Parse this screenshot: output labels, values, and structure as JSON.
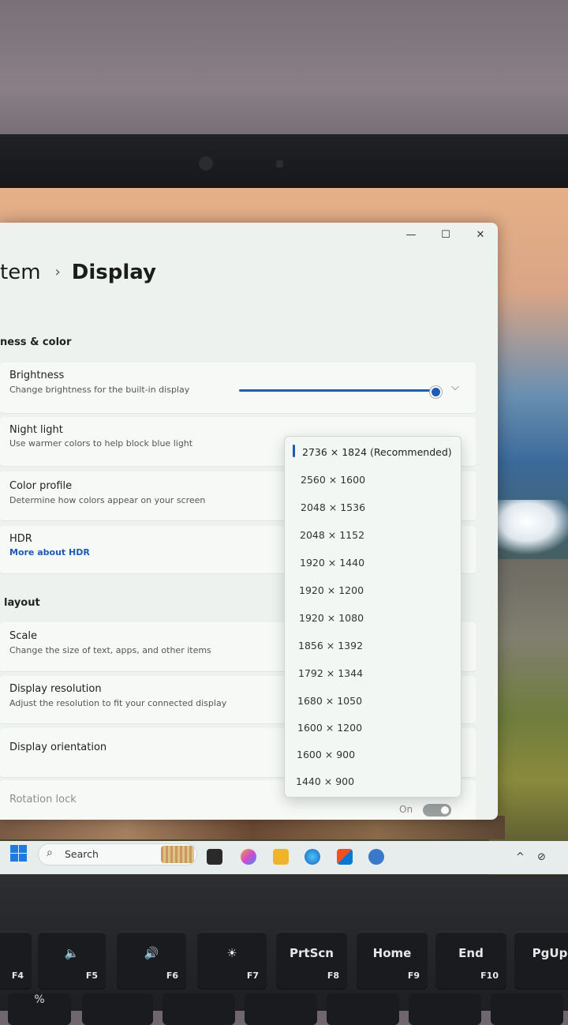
{
  "window": {
    "breadcrumb_parent": "tem",
    "breadcrumb_sep": "›",
    "breadcrumb_current": "Display",
    "minimize": "—",
    "maximize": "☐",
    "close": "✕"
  },
  "sections": {
    "brightness_color": "ness & color",
    "layout": "layout"
  },
  "settings": {
    "brightness": {
      "title": "Brightness",
      "subtitle": "Change brightness for the built-in display",
      "level_percent": 100
    },
    "night_light": {
      "title": "Night light",
      "subtitle": "Use warmer colors to help block blue light"
    },
    "color_profile": {
      "title": "Color profile",
      "subtitle": "Determine how colors appear on your screen"
    },
    "hdr": {
      "title": "HDR",
      "link": "More about HDR"
    },
    "scale": {
      "title": "Scale",
      "subtitle": "Change the size of text, apps, and other items"
    },
    "display_resolution": {
      "title": "Display resolution",
      "subtitle": "Adjust the resolution to fit your connected display"
    },
    "display_orientation": {
      "title": "Display orientation"
    },
    "rotation_lock": {
      "title": "Rotation lock",
      "state": "On"
    }
  },
  "resolution_dropdown": {
    "selected": "2736 × 1824 (Recommended)",
    "options": [
      "2736 × 1824 (Recommended)",
      "2560 × 1600",
      "2048 × 1536",
      "2048 × 1152",
      "1920 × 1440",
      "1920 × 1200",
      "1920 × 1080",
      "1856 × 1392",
      "1792 × 1344",
      "1680 × 1050",
      "1600 × 1200",
      "1600 × 900",
      "1440 × 900"
    ]
  },
  "taskbar": {
    "search_label": "Search",
    "search_icon": "search-icon",
    "tray_chevron": "^"
  },
  "keyboard": {
    "keys": [
      {
        "main": "",
        "sub": "F4"
      },
      {
        "main": "🔈",
        "sub": "F5"
      },
      {
        "main": "🔊",
        "sub": "F6"
      },
      {
        "main": "☀",
        "sub": "F7"
      },
      {
        "main": "PrtScn",
        "sub": "F8"
      },
      {
        "main": "Home",
        "sub": "F9"
      },
      {
        "main": "End",
        "sub": "F10"
      },
      {
        "main": "PgUp",
        "sub": ""
      }
    ],
    "bottom_row": "%"
  },
  "colors": {
    "accent": "#1f5bb5",
    "window_bg": "#edf2ee",
    "card_bg": "#f6f9f6",
    "taskbar_bg": "#e7ecec"
  }
}
